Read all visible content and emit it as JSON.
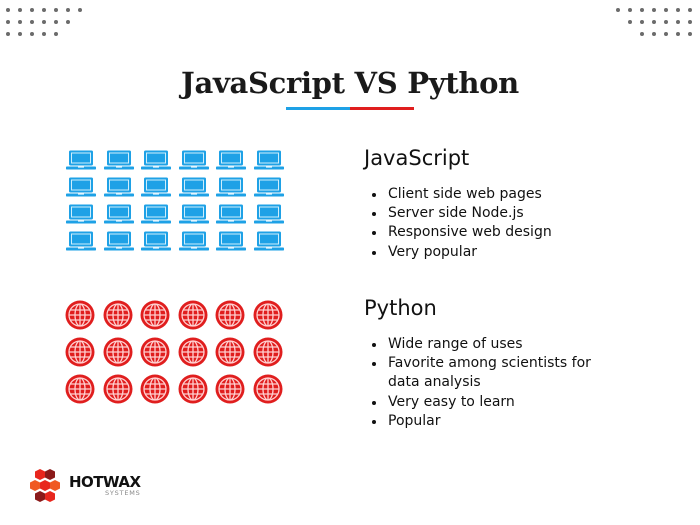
{
  "title": "JavaScript VS Python",
  "colors": {
    "javascript_accent": "#1ea1e6",
    "python_accent": "#e01e1e",
    "dots": "#6b6b6b"
  },
  "javascript": {
    "heading": "JavaScript",
    "icon": "laptop-icon",
    "icon_count": 24,
    "points": [
      "Client side web pages",
      "Server side Node.js",
      "Responsive web design",
      "Very popular"
    ]
  },
  "python": {
    "heading": "Python",
    "icon": "globe-icon",
    "icon_count": 18,
    "points": [
      "Wide range of uses",
      "Favorite among scientists for data analysis",
      "Very easy to learn",
      "Popular"
    ]
  },
  "logo": {
    "name": "HOTWAX",
    "sub": "SYSTEMS"
  }
}
